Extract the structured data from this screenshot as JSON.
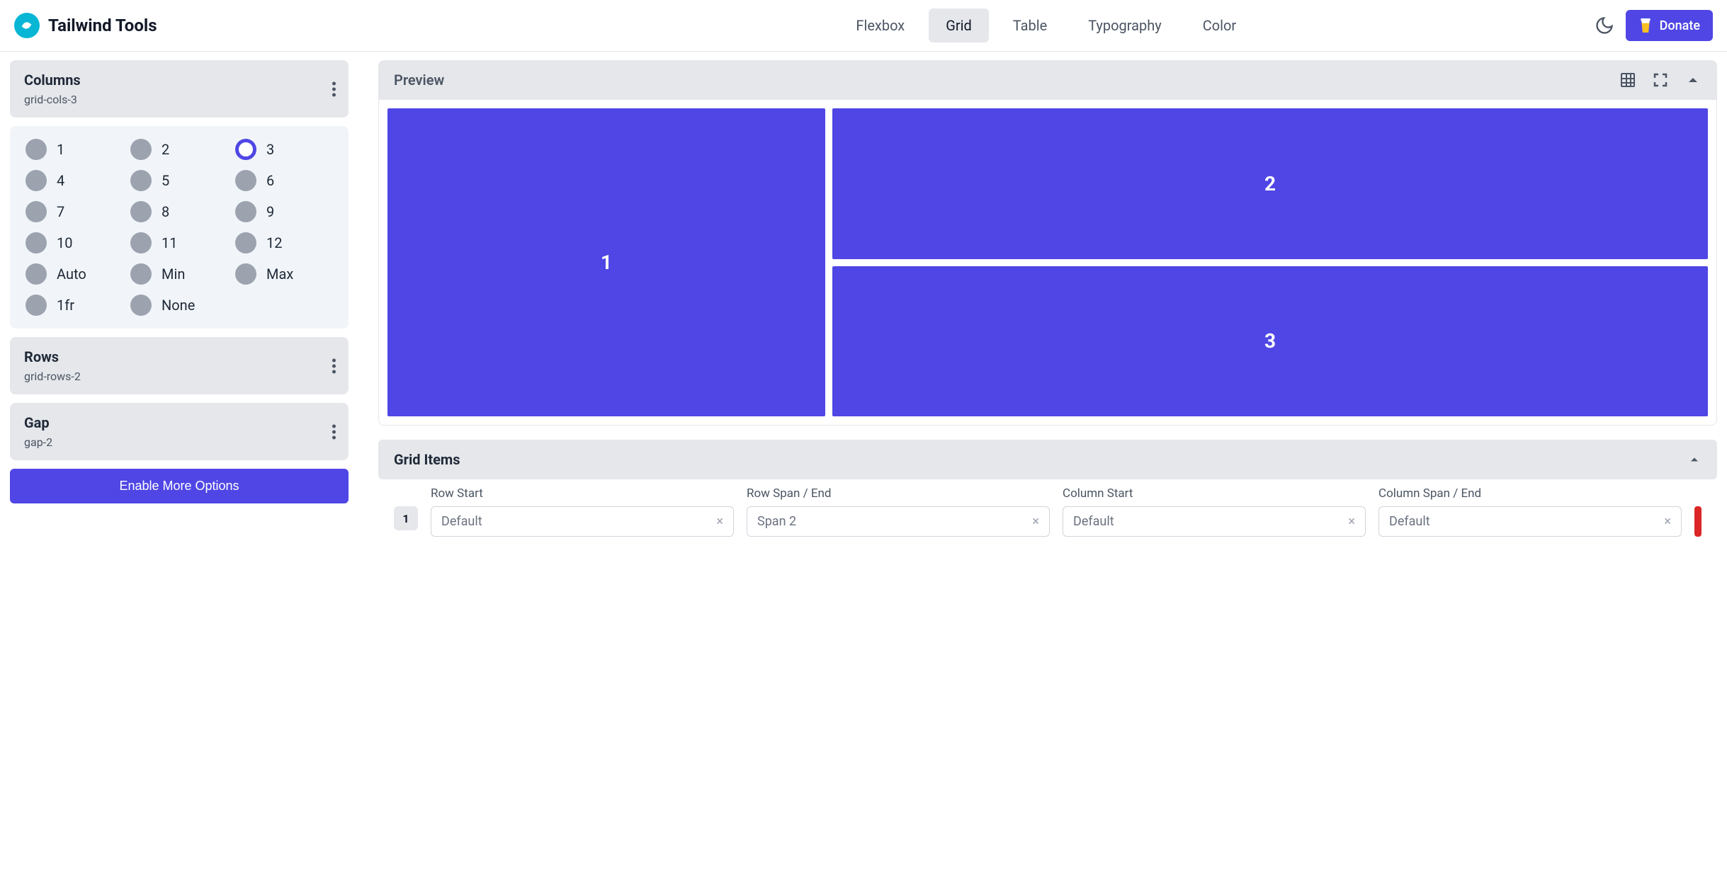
{
  "header": {
    "brand": "Tailwind Tools",
    "nav": [
      "Flexbox",
      "Grid",
      "Table",
      "Typography",
      "Color"
    ],
    "nav_active": "Grid",
    "donate": "Donate"
  },
  "columns": {
    "title": "Columns",
    "sub": "grid-cols-3",
    "options": [
      "1",
      "2",
      "3",
      "4",
      "5",
      "6",
      "7",
      "8",
      "9",
      "10",
      "11",
      "12",
      "Auto",
      "Min",
      "Max",
      "1fr",
      "None"
    ],
    "selected": "3"
  },
  "rows": {
    "title": "Rows",
    "sub": "grid-rows-2"
  },
  "gap": {
    "title": "Gap",
    "sub": "gap-2"
  },
  "enable_btn": "Enable More Options",
  "preview": {
    "title": "Preview",
    "cells": [
      "1",
      "2",
      "3"
    ]
  },
  "grid_items": {
    "title": "Grid Items",
    "item_num": "1",
    "cols": [
      "Row Start",
      "Row Span / End",
      "Column Start",
      "Column Span / End"
    ],
    "values": [
      "Default",
      "Span 2",
      "Default",
      "Default"
    ]
  }
}
